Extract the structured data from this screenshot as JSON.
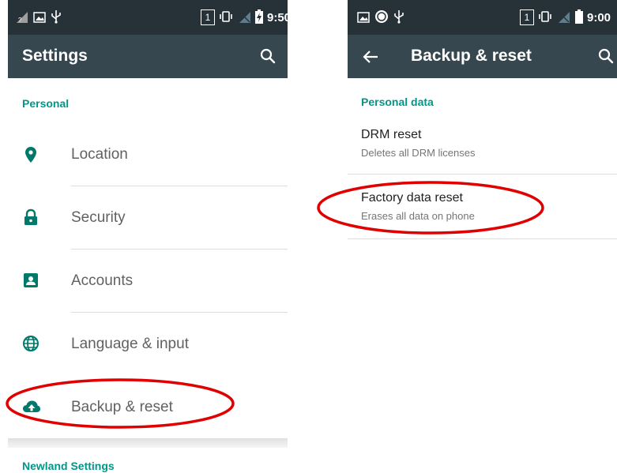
{
  "left": {
    "status": {
      "time": "9:50",
      "sim_slot": "1"
    },
    "appbar": {
      "title": "Settings"
    },
    "personal_header": "Personal",
    "items": [
      {
        "label": "Location",
        "icon": "location-pin-icon"
      },
      {
        "label": "Security",
        "icon": "lock-icon"
      },
      {
        "label": "Accounts",
        "icon": "account-box-icon"
      },
      {
        "label": "Language & input",
        "icon": "globe-icon"
      },
      {
        "label": "Backup & reset",
        "icon": "cloud-upload-icon"
      }
    ],
    "newland_header": "Newland Settings"
  },
  "right": {
    "status": {
      "time": "9:00",
      "sim_slot": "1"
    },
    "appbar": {
      "title": "Backup & reset"
    },
    "section_header": "Personal data",
    "items": [
      {
        "title": "DRM reset",
        "subtitle": "Deletes all DRM licenses"
      },
      {
        "title": "Factory data reset",
        "subtitle": "Erases all data on phone"
      }
    ]
  },
  "colors": {
    "status_bar": "#263238",
    "app_bar": "#37474f",
    "accent": "#009688",
    "highlight_ring": "#e00000"
  }
}
